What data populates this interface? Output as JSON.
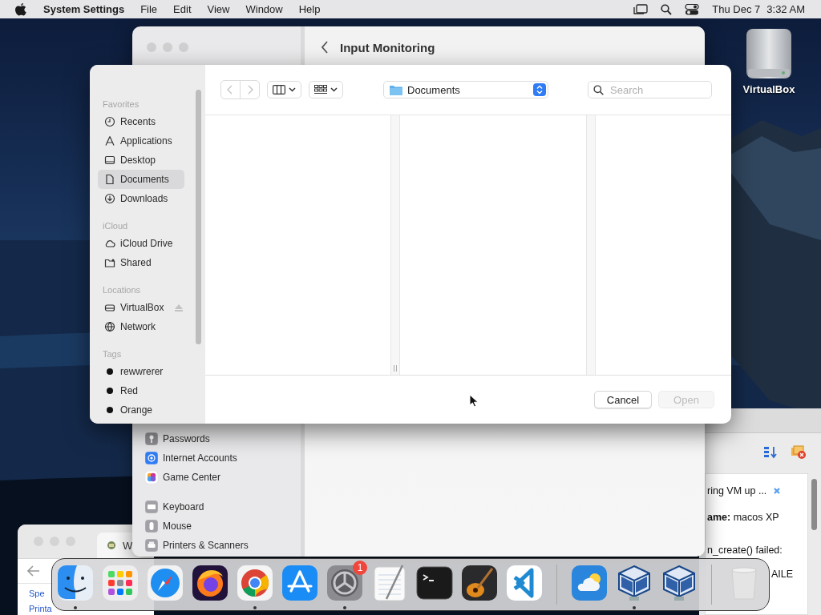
{
  "menu_bar": {
    "app_name": "System Settings",
    "menus": [
      "File",
      "Edit",
      "View",
      "Window",
      "Help"
    ],
    "date": "Thu Dec 7",
    "time": "3:32 AM"
  },
  "desktop_icons": [
    {
      "label": "VirtualBox"
    }
  ],
  "settings_window": {
    "title": "Input Monitoring",
    "sidebar_groups": [
      {
        "items": [
          {
            "label": "Passwords",
            "kind": "key"
          },
          {
            "label": "Internet Accounts",
            "kind": "at"
          },
          {
            "label": "Game Center",
            "kind": "game"
          }
        ]
      },
      {
        "items": [
          {
            "label": "Keyboard",
            "kind": "keyboard"
          },
          {
            "label": "Mouse",
            "kind": "mouse"
          },
          {
            "label": "Printers & Scanners",
            "kind": "printer"
          }
        ]
      }
    ]
  },
  "open_dialog": {
    "location": "Documents",
    "search": {
      "placeholder": "Search"
    },
    "sidebar": [
      {
        "heading": "Favorites",
        "items": [
          {
            "label": "Recents",
            "kind": "clock",
            "selected": false
          },
          {
            "label": "Applications",
            "kind": "apps",
            "selected": false
          },
          {
            "label": "Desktop",
            "kind": "desktop",
            "selected": false
          },
          {
            "label": "Documents",
            "kind": "document",
            "selected": true
          },
          {
            "label": "Downloads",
            "kind": "download",
            "selected": false
          }
        ]
      },
      {
        "heading": "iCloud",
        "items": [
          {
            "label": "iCloud Drive",
            "kind": "cloud",
            "selected": false
          },
          {
            "label": "Shared",
            "kind": "shared",
            "selected": false
          }
        ]
      },
      {
        "heading": "Locations",
        "items": [
          {
            "label": "VirtualBox",
            "kind": "drive",
            "selected": false
          },
          {
            "label": "Network",
            "kind": "globe",
            "selected": false
          }
        ]
      },
      {
        "heading": "Tags",
        "items": [
          {
            "label": "rewwrerer",
            "kind": "tag",
            "selected": false
          },
          {
            "label": "Red",
            "kind": "tag",
            "selected": false
          },
          {
            "label": "Orange",
            "kind": "tag",
            "selected": false
          }
        ]
      }
    ],
    "buttons": [
      {
        "label": "Cancel",
        "disabled": false
      },
      {
        "label": "Open",
        "disabled": true
      }
    ]
  },
  "vbox_window": {
    "lines": [
      "ring VM up ...",
      "**ame:** macos XP",
      "n_create() failed:",
      "AILE"
    ]
  },
  "web_window": {
    "tab": "W",
    "links": [
      "Spe",
      "Printa"
    ]
  },
  "dock": {
    "sections": [
      {
        "apps": [
          {
            "kind": "finder",
            "running": true
          },
          {
            "kind": "launchpad",
            "running": false
          },
          {
            "kind": "safari",
            "running": false
          },
          {
            "kind": "firefox",
            "running": false
          },
          {
            "kind": "chrome",
            "running": true
          },
          {
            "kind": "appstore",
            "running": false
          },
          {
            "kind": "settings",
            "running": true,
            "badge": "1"
          },
          {
            "kind": "textedit",
            "running": false
          },
          {
            "kind": "terminal",
            "running": false
          },
          {
            "kind": "garageband",
            "running": false
          },
          {
            "kind": "vscode",
            "running": false
          }
        ]
      },
      {
        "apps": [
          {
            "kind": "weather",
            "running": false
          },
          {
            "kind": "virtualbox",
            "running": true
          },
          {
            "kind": "virtualbox",
            "running": false
          }
        ]
      },
      {
        "apps": [
          {
            "kind": "trash",
            "running": false
          }
        ]
      }
    ]
  }
}
